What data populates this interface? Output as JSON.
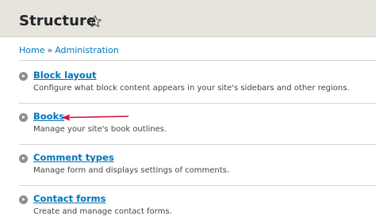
{
  "header": {
    "title": "Structure",
    "favorite_icon": "star-outline-icon"
  },
  "breadcrumb": [
    {
      "label": "Home"
    },
    {
      "label": "Administration"
    }
  ],
  "breadcrumb_separator": "»",
  "items": [
    {
      "title": "Block layout",
      "description": "Configure what block content appears in your site's sidebars and other regions."
    },
    {
      "title": "Books",
      "description": "Manage your site's book outlines."
    },
    {
      "title": "Comment types",
      "description": "Manage form and displays settings of comments."
    },
    {
      "title": "Contact forms",
      "description": "Create and manage contact forms."
    }
  ],
  "colors": {
    "link": "#0074bd",
    "header_bg": "#e7e4de",
    "annotation_arrow": "#d0173a"
  }
}
